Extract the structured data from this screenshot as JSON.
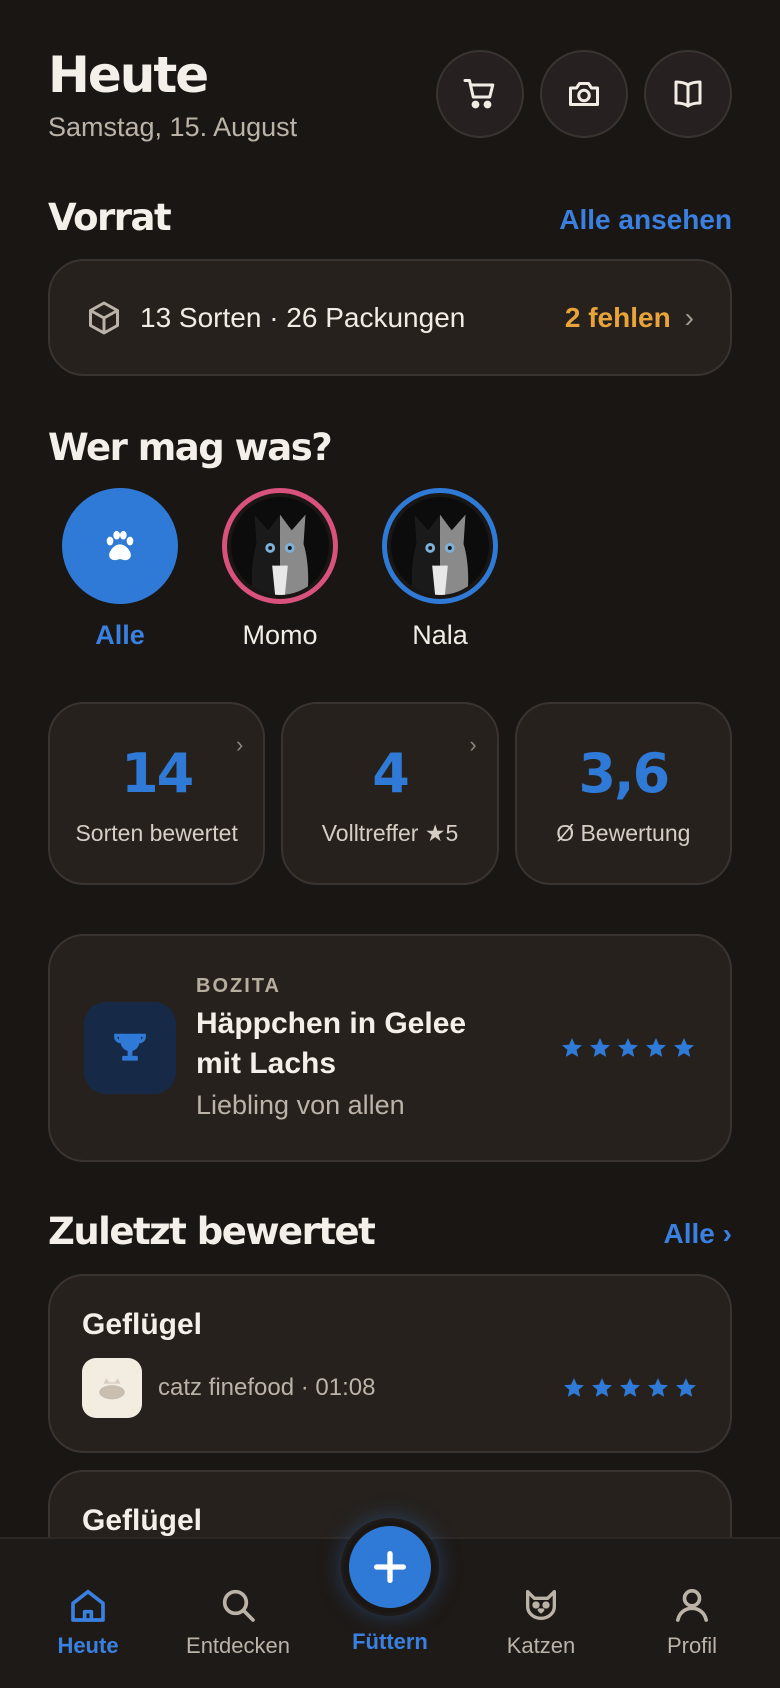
{
  "header": {
    "title": "Heute",
    "date": "Samstag, 15. August"
  },
  "vorrat": {
    "title": "Vorrat",
    "link": "Alle ansehen",
    "summary": "13 Sorten · 26 Packungen",
    "missing": "2 fehlen"
  },
  "cats": {
    "title": "Wer mag was?",
    "items": [
      {
        "name": "Alle",
        "active": true
      },
      {
        "name": "Momo",
        "ring": "#d9527e"
      },
      {
        "name": "Nala",
        "ring": "#2f7ad6"
      }
    ]
  },
  "stats": [
    {
      "value": "14",
      "label": "Sorten bewertet"
    },
    {
      "value": "4",
      "label": "Volltreffer ★5"
    },
    {
      "value": "3,6",
      "label": "Ø Bewertung"
    }
  ],
  "favorite": {
    "brand": "BOZITA",
    "name": "Häppchen in Gelee mit Lachs",
    "subtitle": "Liebling von allen",
    "rating": 5
  },
  "recent": {
    "title": "Zuletzt bewertet",
    "link": "Alle ›",
    "items": [
      {
        "name": "Geflügel",
        "meta": "catz finefood · 01:08",
        "rating": 5
      },
      {
        "name": "Geflügel"
      }
    ]
  },
  "tabbar": {
    "home": "Heute",
    "discover": "Entdecken",
    "feed": "Füttern",
    "cats": "Katzen",
    "profile": "Profil"
  },
  "colors": {
    "accent": "#2f7ad6",
    "warning": "#e8a33a",
    "background": "#1a1613",
    "card": "#26211d"
  }
}
